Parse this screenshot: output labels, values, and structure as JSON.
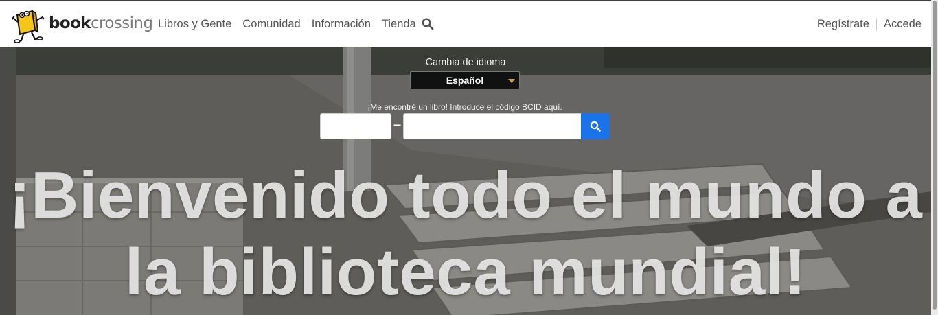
{
  "header": {
    "logo": {
      "bold": "book",
      "light": "crossing"
    },
    "nav": [
      {
        "label": "Libros y Gente"
      },
      {
        "label": "Comunidad"
      },
      {
        "label": "Información"
      },
      {
        "label": "Tienda"
      }
    ],
    "search_icon": "search-icon",
    "register_label": "Regístrate",
    "login_label": "Accede"
  },
  "hero": {
    "language_label": "Cambia de idioma",
    "language_selected": "Español",
    "bcid_label": "¡Me encontré un libro! Introduce el código BCID aquí.",
    "bcid_separator": "–",
    "bcid_search_icon": "search-icon",
    "headline": "¡Bienvenido todo el mundo a la biblioteca mundial!"
  },
  "colors": {
    "accent": "#1a73e8",
    "logo_yellow": "#f5c518",
    "nav_text": "#555555"
  }
}
